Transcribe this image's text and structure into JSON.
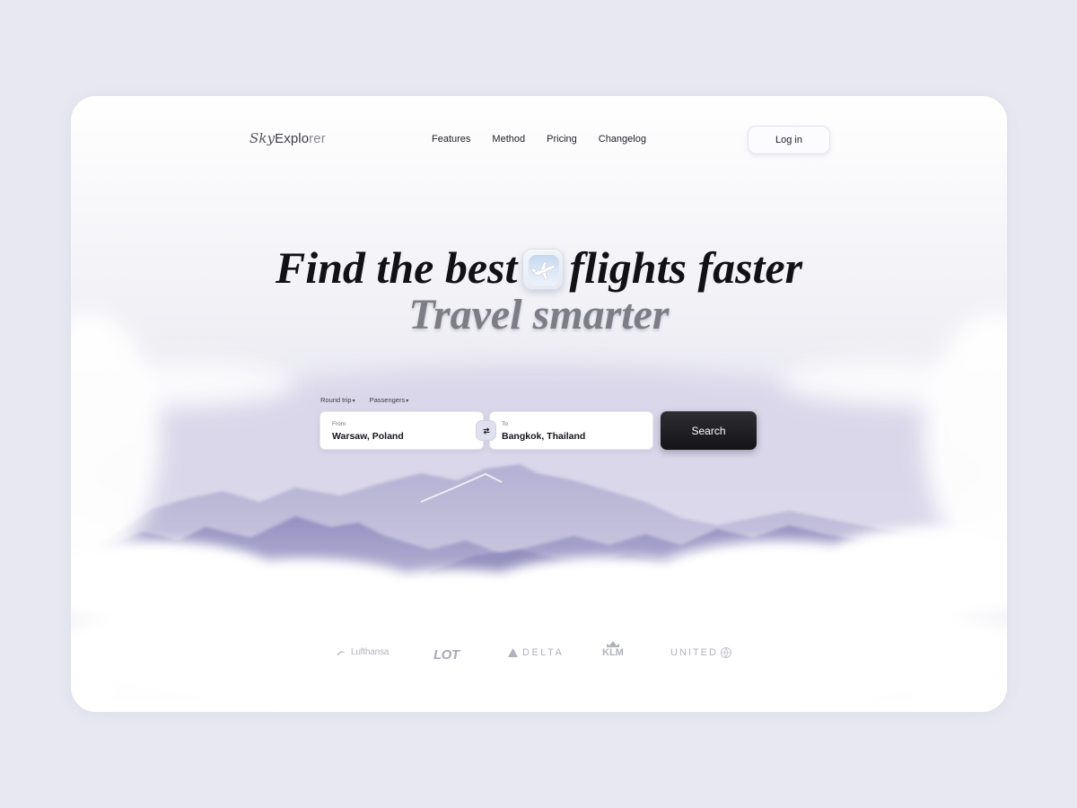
{
  "brand": {
    "logo_sky": "Sky",
    "logo_expl": "Explo",
    "logo_rer": "rer"
  },
  "nav": {
    "items": [
      "Features",
      "Method",
      "Pricing",
      "Changelog"
    ],
    "login_label": "Log in"
  },
  "hero": {
    "headline_part1": "Find the best",
    "headline_part2": "flights faster",
    "subheadline": "Travel smarter",
    "badge_icon": "airplane-icon"
  },
  "search": {
    "trip_type": "Round trip",
    "passengers": "Passengers",
    "from_label": "From",
    "from_value": "Warsaw, Poland",
    "to_label": "To",
    "to_value": "Bangkok, Thailand",
    "swap_icon": "swap-arrows-icon",
    "button_label": "Search"
  },
  "airlines": [
    "Lufthansa",
    "LOT",
    "DELTA",
    "KLM",
    "UNITED"
  ],
  "colors": {
    "page_bg": "#e8e8f1",
    "card_bg": "#fbfbfd",
    "mountains": "#9d98c4",
    "search_button": "#1c1c20",
    "heading": "#111116",
    "subheading": "#7d7d86"
  }
}
